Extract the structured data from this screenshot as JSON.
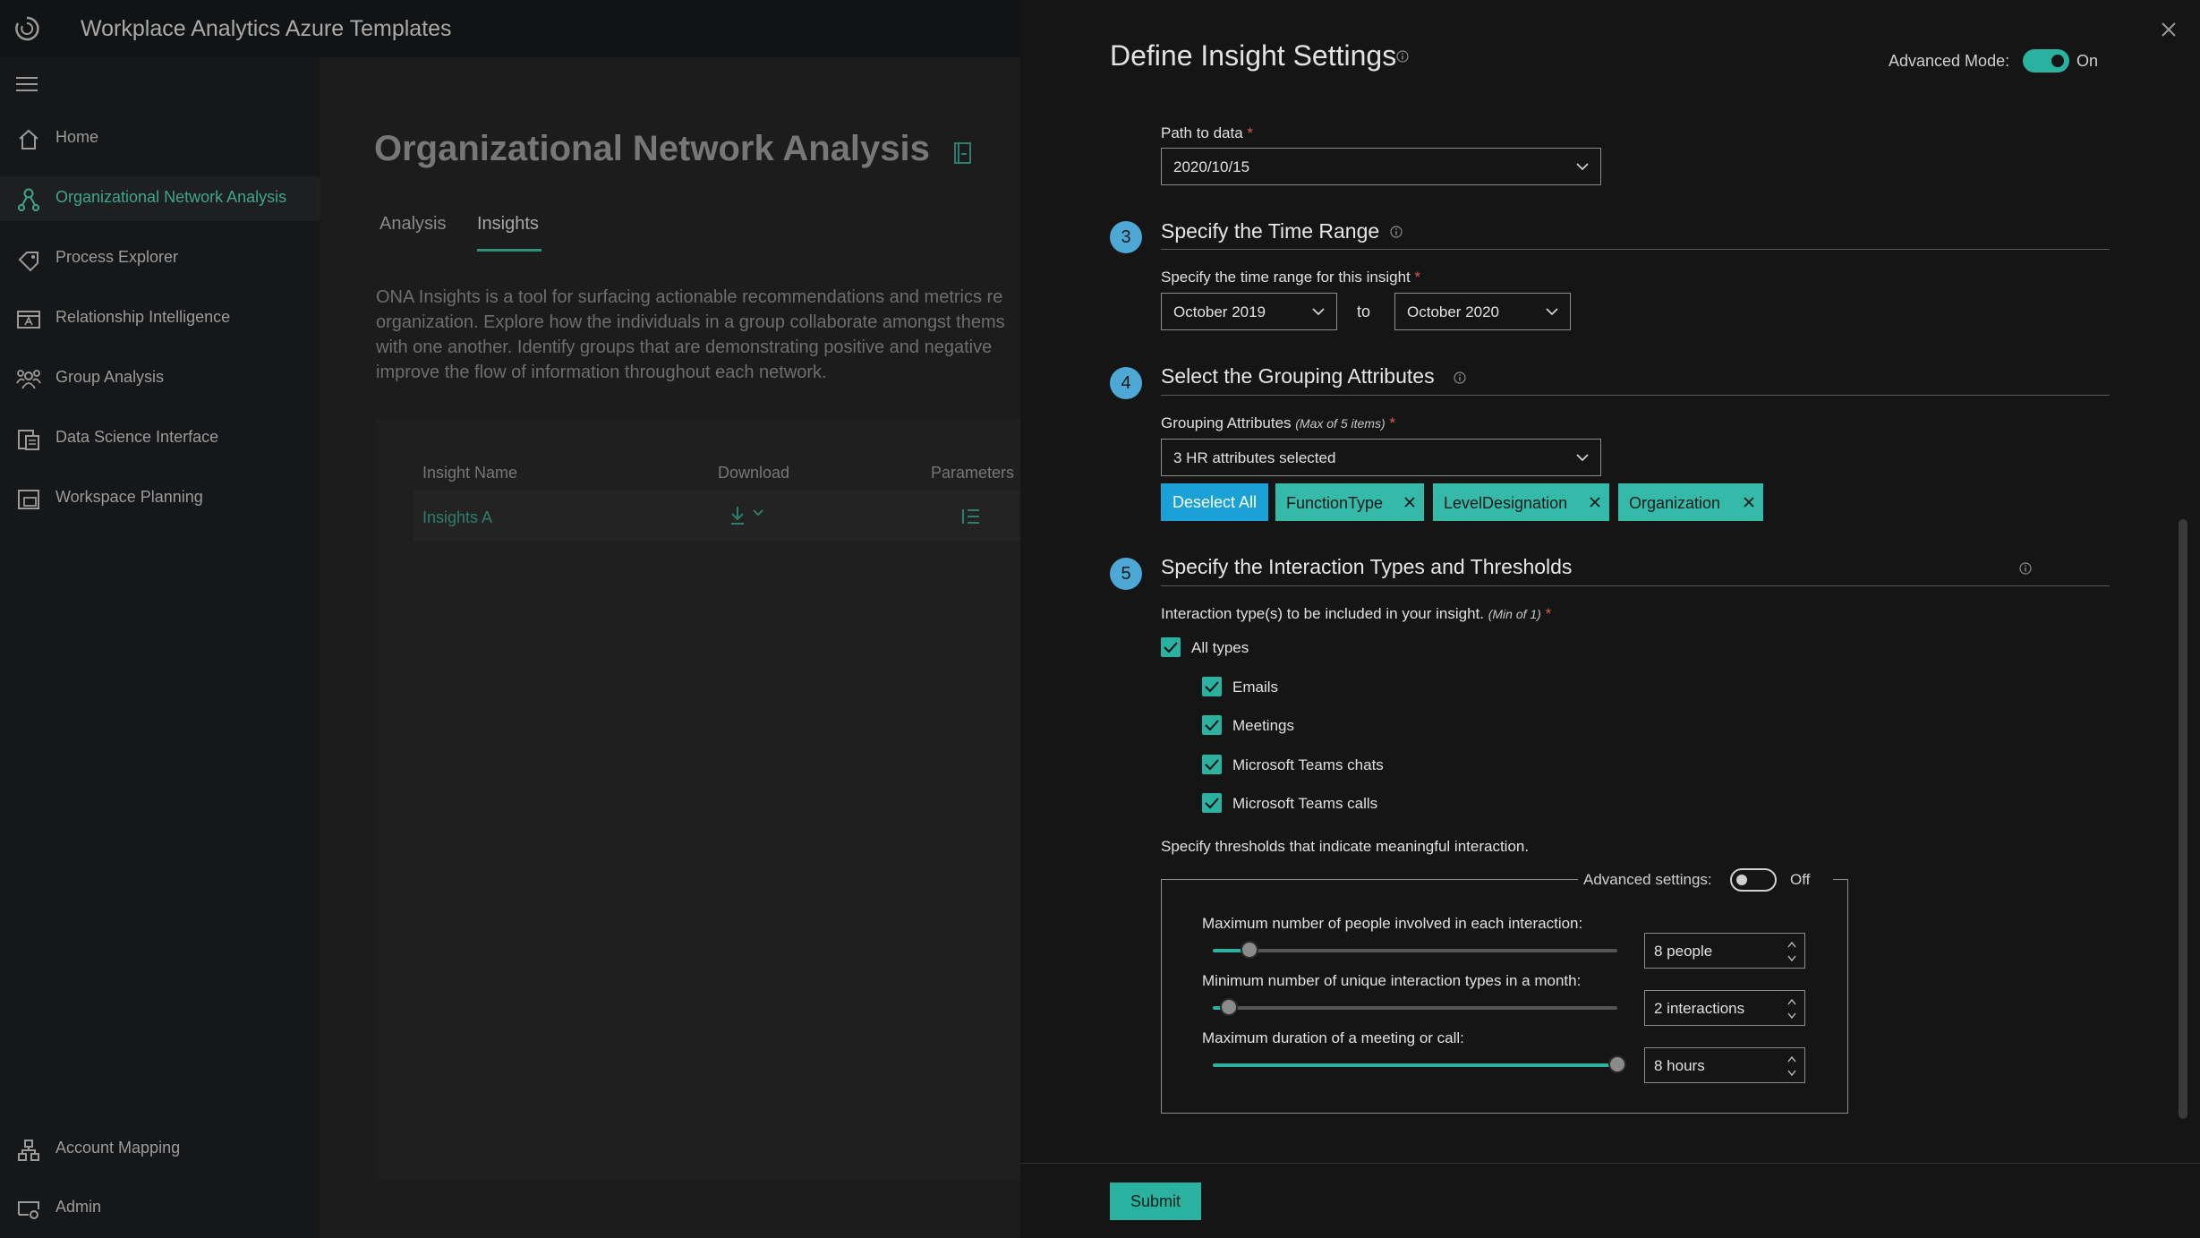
{
  "app": {
    "title": "Workplace Analytics Azure Templates"
  },
  "sidebar": {
    "items": [
      {
        "label": "Home",
        "icon": "home-icon"
      },
      {
        "label": "Organizational Network Analysis",
        "icon": "network-person-icon",
        "active": true
      },
      {
        "label": "Process Explorer",
        "icon": "tag-icon"
      },
      {
        "label": "Relationship Intelligence",
        "icon": "contact-card-icon"
      },
      {
        "label": "Group Analysis",
        "icon": "group-icon"
      },
      {
        "label": "Data Science Interface",
        "icon": "document-grid-icon"
      },
      {
        "label": "Workspace Planning",
        "icon": "workspace-icon"
      }
    ],
    "bottom_items": [
      {
        "label": "Account Mapping",
        "icon": "hierarchy-icon"
      },
      {
        "label": "Admin",
        "icon": "admin-icon"
      }
    ]
  },
  "main": {
    "title": "Organizational Network Analysis",
    "tabs": [
      {
        "label": "Analysis"
      },
      {
        "label": "Insights",
        "active": true
      }
    ],
    "description": "ONA Insights is a tool for surfacing actionable recommendations and metrics re\norganization. Explore how the individuals in a group collaborate amongst thems\nwith one another. Identify groups that are demonstrating positive and negative\nimprove the flow of information throughout each network.",
    "table": {
      "headers": [
        "Insight Name",
        "Download",
        "Parameters"
      ],
      "rows": [
        {
          "name": "Insights A"
        }
      ]
    }
  },
  "panel": {
    "title": "Define Insight Settings",
    "advanced_mode": {
      "label": "Advanced Mode:",
      "state": "On"
    },
    "path": {
      "label": "Path to data",
      "value": "2020/10/15"
    },
    "sections": [
      {
        "number": "3",
        "title": "Specify the Time Range"
      },
      {
        "number": "4",
        "title": "Select the Grouping Attributes"
      },
      {
        "number": "5",
        "title": "Specify the Interaction Types and Thresholds"
      }
    ],
    "time_range": {
      "label": "Specify the time range for this insight",
      "from": "October 2019",
      "to_label": "to",
      "to": "October 2020"
    },
    "grouping": {
      "label": "Grouping Attributes",
      "note": "(Max of 5 items)",
      "value": "3 HR attributes selected",
      "deselect_label": "Deselect All",
      "chips": [
        "FunctionType",
        "LevelDesignation",
        "Organization"
      ]
    },
    "interaction": {
      "label": "Interaction type(s) to be included in your insight.",
      "note": "(Min of 1)",
      "all_label": "All types",
      "types": [
        "Emails",
        "Meetings",
        "Microsoft Teams chats",
        "Microsoft Teams calls"
      ]
    },
    "thresholds": {
      "label": "Specify thresholds that indicate meaningful interaction.",
      "advanced": {
        "label": "Advanced settings:",
        "state": "Off"
      },
      "sliders": [
        {
          "label": "Maximum number of people involved in each interaction:",
          "value": "8 people",
          "level": 0.09
        },
        {
          "label": "Minimum number of unique interaction types in a month:",
          "value": "2 interactions",
          "level": 0.04
        },
        {
          "label": "Maximum duration of a meeting or call:",
          "value": "8 hours",
          "level": 1.0
        }
      ]
    },
    "submit_label": "Submit"
  },
  "colors": {
    "accent": "#2ab19f",
    "step": "#4da8d6",
    "primary_button": "#1aa1d8",
    "required": "#e2574c"
  }
}
